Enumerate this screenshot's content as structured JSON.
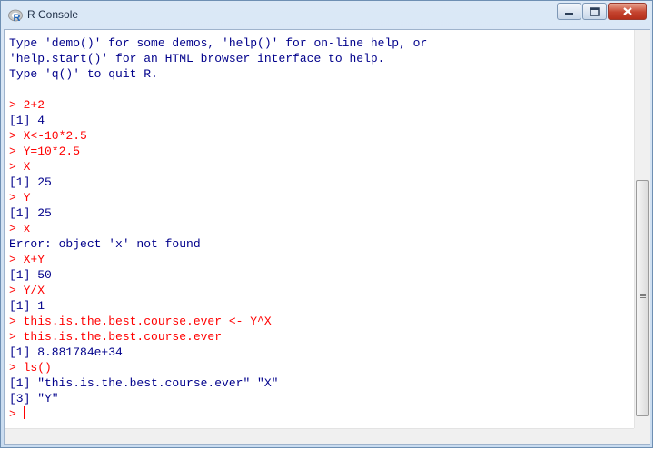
{
  "window": {
    "title": "R Console",
    "icon": "r-logo-icon"
  },
  "title_buttons": [
    "minimize-icon",
    "maximize-icon",
    "close-icon"
  ],
  "console": {
    "lines": [
      {
        "type": "banner",
        "text": "Type 'demo()' for some demos, 'help()' for on-line help, or"
      },
      {
        "type": "banner",
        "text": "'help.start()' for an HTML browser interface to help."
      },
      {
        "type": "banner",
        "text": "Type 'q()' to quit R."
      },
      {
        "type": "blank",
        "text": ""
      },
      {
        "type": "input",
        "text": "> 2+2"
      },
      {
        "type": "output",
        "text": "[1] 4"
      },
      {
        "type": "input",
        "text": "> X<-10*2.5"
      },
      {
        "type": "input",
        "text": "> Y=10*2.5"
      },
      {
        "type": "input",
        "text": "> X"
      },
      {
        "type": "output",
        "text": "[1] 25"
      },
      {
        "type": "input",
        "text": "> Y"
      },
      {
        "type": "output",
        "text": "[1] 25"
      },
      {
        "type": "input",
        "text": "> x"
      },
      {
        "type": "output",
        "text": "Error: object 'x' not found"
      },
      {
        "type": "input",
        "text": "> X+Y"
      },
      {
        "type": "output",
        "text": "[1] 50"
      },
      {
        "type": "input",
        "text": "> Y/X"
      },
      {
        "type": "output",
        "text": "[1] 1"
      },
      {
        "type": "input",
        "text": "> this.is.the.best.course.ever <- Y^X"
      },
      {
        "type": "input",
        "text": "> this.is.the.best.course.ever"
      },
      {
        "type": "output",
        "text": "[1] 8.881784e+34"
      },
      {
        "type": "input",
        "text": "> ls()"
      },
      {
        "type": "output",
        "text": "[1] \"this.is.the.best.course.ever\" \"X\""
      },
      {
        "type": "output",
        "text": "[3] \"Y\""
      }
    ],
    "prompt": "> "
  },
  "colors": {
    "input": "#ff0000",
    "output": "#00008b",
    "titlebar": "#c9dcf0",
    "close": "#c5442f"
  },
  "scroll": {
    "vertical_position_fraction": 0.62
  }
}
